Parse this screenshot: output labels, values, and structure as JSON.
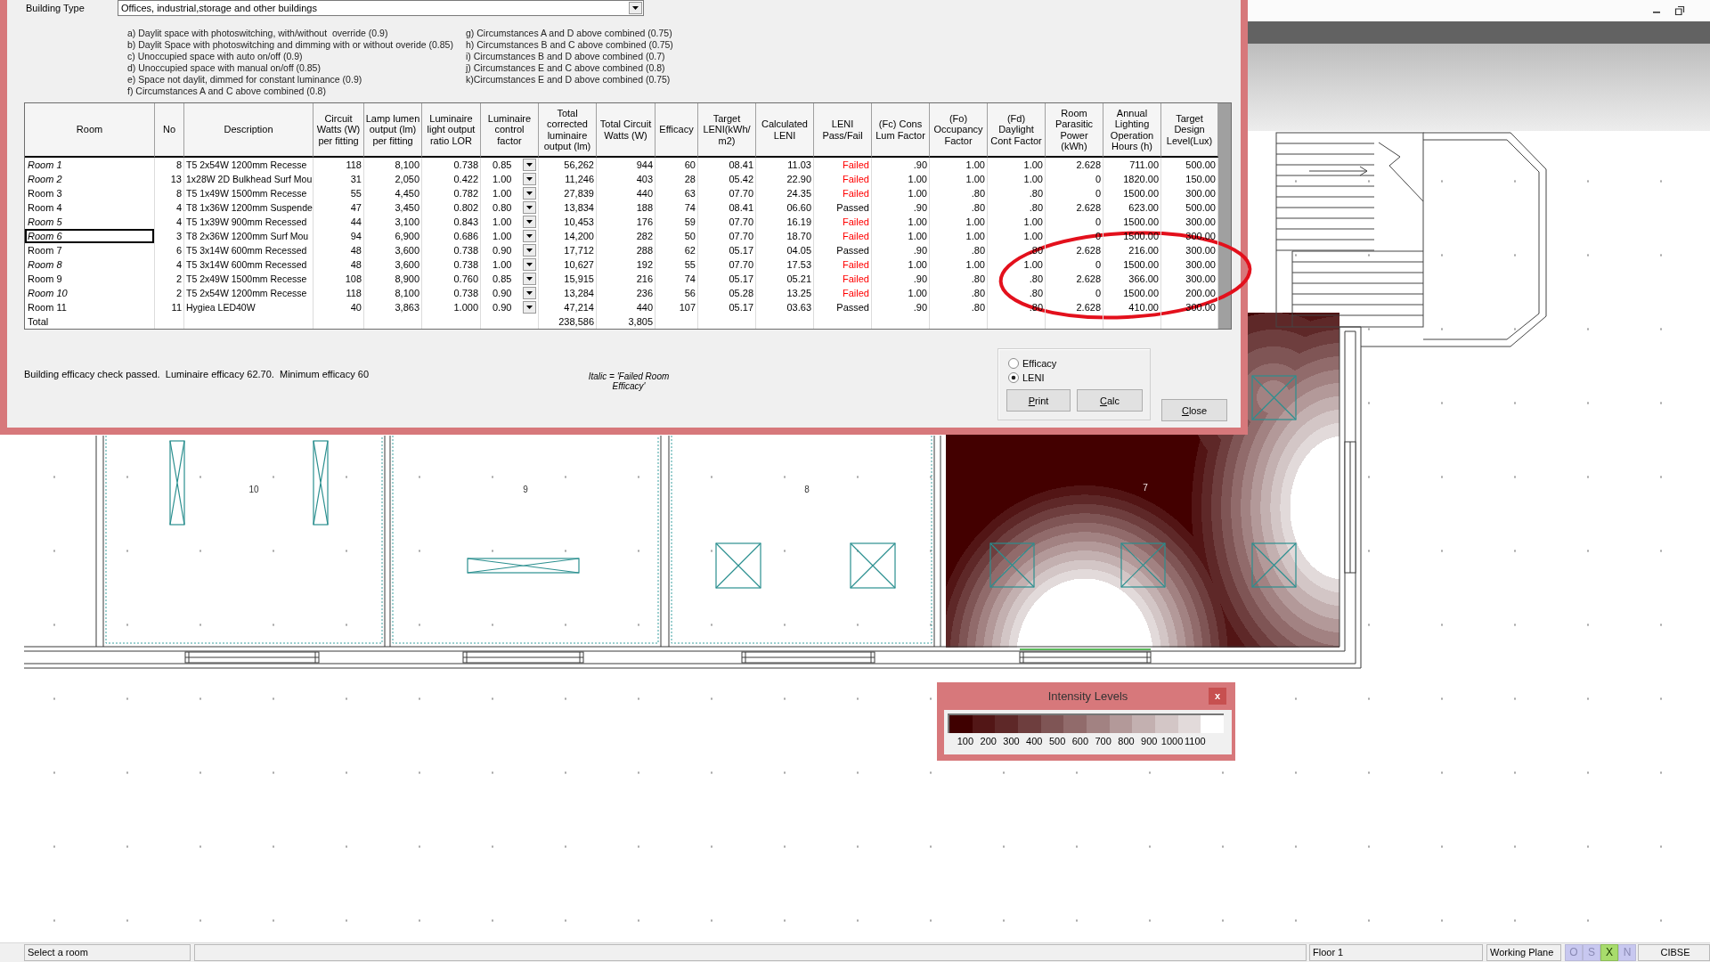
{
  "dialog": {
    "building_type": {
      "label": "Building Type",
      "value": "Offices, industrial,storage and other buildings"
    },
    "factor_notes": [
      {
        "lines": [
          "a) Daylit space with photoswitching, with/without  override (0.9)",
          "b) Daylit Space with photoswitching and dimming with or without overide (0.85)",
          "c) Unoccupied space with auto on/off (0.9)",
          "d) Unoccupied space with manual on/off (0.85)",
          "e) Space not daylit, dimmed for constant luminance (0.9)",
          "f) Circumstances A and C above combined (0.8)"
        ]
      },
      {
        "lines": [
          "g) Circumstances A and D above combined (0.75)",
          "h) Circumstances B and C above combined (0.75)",
          "i) Circumstances B and D above combined (0.7)",
          "j) Circumstances E and C above combined (0.8)",
          "k)Circumstances E and D above combined (0.75)"
        ]
      }
    ],
    "table": {
      "columns": [
        {
          "label": "Room",
          "kind": "room"
        },
        {
          "label": "No",
          "kind": "number"
        },
        {
          "label": "Description",
          "kind": "text"
        },
        {
          "label": "Circuit Watts (W) per fitting",
          "kind": "number"
        },
        {
          "label": "Lamp lumen output (lm) per fitting",
          "kind": "number"
        },
        {
          "label": "Luminaire light output ratio LOR",
          "kind": "number"
        },
        {
          "label": "Luminaire control factor",
          "kind": "dropdown"
        },
        {
          "label": "Total corrected luminaire output (lm)",
          "kind": "number"
        },
        {
          "label": "Total Circuit Watts (W)",
          "kind": "number"
        },
        {
          "label": "Efficacy",
          "kind": "number"
        },
        {
          "label": "Target LENI(kWh/m2)",
          "kind": "number"
        },
        {
          "label": "Calculated LENI",
          "kind": "number"
        },
        {
          "label": "LENI Pass/Fail",
          "kind": "status"
        },
        {
          "label": "(Fc) Cons Lum Factor",
          "kind": "number"
        },
        {
          "label": "(Fo) Occupancy Factor",
          "kind": "number"
        },
        {
          "label": "(Fd) Daylight Cont Factor",
          "kind": "number"
        },
        {
          "label": "Room Parasitic Power (kWh)",
          "kind": "number"
        },
        {
          "label": "Annual Lighting Operation Hours (h)",
          "kind": "number"
        },
        {
          "label": "Target Design Level(Lux)",
          "kind": "number"
        }
      ],
      "rows": [
        {
          "cells": [
            "Room 1",
            "8",
            "T5 2x54W 1200mm Recesse",
            "118",
            "8,100",
            "0.738",
            "0.85",
            "56,262",
            "944",
            "60",
            "08.41",
            "11.03",
            "Failed",
            ".90",
            "1.00",
            "1.00",
            "2.628",
            "711.00",
            "500.00"
          ],
          "efficacy_failed": true,
          "leni_failed": true,
          "selected": false
        },
        {
          "cells": [
            "Room 2",
            "13",
            "1x28W 2D Bulkhead Surf Mou",
            "31",
            "2,050",
            "0.422",
            "1.00",
            "11,246",
            "403",
            "28",
            "05.42",
            "22.90",
            "Failed",
            "1.00",
            "1.00",
            "1.00",
            "0",
            "1820.00",
            "150.00"
          ],
          "efficacy_failed": true,
          "leni_failed": true,
          "selected": false
        },
        {
          "cells": [
            "Room 3",
            "8",
            "T5 1x49W 1500mm Recesse",
            "55",
            "4,450",
            "0.782",
            "1.00",
            "27,839",
            "440",
            "63",
            "07.70",
            "24.35",
            "Failed",
            "1.00",
            ".80",
            ".80",
            "0",
            "1500.00",
            "300.00"
          ],
          "efficacy_failed": false,
          "leni_failed": true,
          "selected": false
        },
        {
          "cells": [
            "Room 4",
            "4",
            "T8 1x36W 1200mm Suspende",
            "47",
            "3,450",
            "0.802",
            "0.80",
            "13,834",
            "188",
            "74",
            "08.41",
            "06.60",
            "Passed",
            ".90",
            ".80",
            ".80",
            "2.628",
            "623.00",
            "500.00"
          ],
          "efficacy_failed": false,
          "leni_failed": false,
          "selected": false
        },
        {
          "cells": [
            "Room 5",
            "4",
            "T5 1x39W 900mm Recessed",
            "44",
            "3,100",
            "0.843",
            "1.00",
            "10,453",
            "176",
            "59",
            "07.70",
            "16.19",
            "Failed",
            "1.00",
            "1.00",
            "1.00",
            "0",
            "1500.00",
            "300.00"
          ],
          "efficacy_failed": true,
          "leni_failed": true,
          "selected": false
        },
        {
          "cells": [
            "Room 6",
            "3",
            "T8 2x36W 1200mm Surf Mou",
            "94",
            "6,900",
            "0.686",
            "1.00",
            "14,200",
            "282",
            "50",
            "07.70",
            "18.70",
            "Failed",
            "1.00",
            "1.00",
            "1.00",
            "0",
            "1500.00",
            "300.00"
          ],
          "efficacy_failed": true,
          "leni_failed": true,
          "selected": true
        },
        {
          "cells": [
            "Room 7",
            "6",
            "T5 3x14W 600mm Recessed",
            "48",
            "3,600",
            "0.738",
            "0.90",
            "17,712",
            "288",
            "62",
            "05.17",
            "04.05",
            "Passed",
            ".90",
            ".80",
            ".80",
            "2.628",
            "216.00",
            "300.00"
          ],
          "efficacy_failed": false,
          "leni_failed": false,
          "selected": false
        },
        {
          "cells": [
            "Room 8",
            "4",
            "T5 3x14W 600mm Recessed",
            "48",
            "3,600",
            "0.738",
            "1.00",
            "10,627",
            "192",
            "55",
            "07.70",
            "17.53",
            "Failed",
            "1.00",
            "1.00",
            "1.00",
            "0",
            "1500.00",
            "300.00"
          ],
          "efficacy_failed": true,
          "leni_failed": true,
          "selected": false
        },
        {
          "cells": [
            "Room 9",
            "2",
            "T5 2x49W 1500mm Recesse",
            "108",
            "8,900",
            "0.760",
            "0.85",
            "15,915",
            "216",
            "74",
            "05.17",
            "05.21",
            "Failed",
            ".90",
            ".80",
            ".80",
            "2.628",
            "366.00",
            "300.00"
          ],
          "efficacy_failed": false,
          "leni_failed": true,
          "selected": false
        },
        {
          "cells": [
            "Room 10",
            "2",
            "T5 2x54W 1200mm Recesse",
            "118",
            "8,100",
            "0.738",
            "0.90",
            "13,284",
            "236",
            "56",
            "05.28",
            "13.25",
            "Failed",
            "1.00",
            ".80",
            ".80",
            "0",
            "1500.00",
            "200.00"
          ],
          "efficacy_failed": true,
          "leni_failed": true,
          "selected": false
        },
        {
          "cells": [
            "Room 11",
            "11",
            "Hygiea LED40W",
            "40",
            "3,863",
            "1.000",
            "0.90",
            "47,214",
            "440",
            "107",
            "05.17",
            "03.63",
            "Passed",
            ".90",
            ".80",
            ".80",
            "2.628",
            "410.00",
            "300.00"
          ],
          "efficacy_failed": false,
          "leni_failed": false,
          "selected": false
        }
      ],
      "total_row": {
        "label": "Total",
        "total_corrected": "238,586",
        "total_circuit": "3,805"
      }
    },
    "status_message": "Building efficacy check passed.  Luminaire efficacy 62.70.  Minimum efficacy 60",
    "legend_note": "Italic = 'Failed Room Efficacy'",
    "mode_options": [
      {
        "label": "Efficacy",
        "selected": false
      },
      {
        "label": "LENI",
        "selected": true
      }
    ],
    "buttons": [
      "Print",
      "Calc"
    ],
    "close_button": "Close"
  },
  "annotations": [
    {
      "kind": "ellipse"
    }
  ],
  "floor_plan": {
    "room_labels": [
      "10",
      "9",
      "8",
      "7"
    ]
  },
  "intensity_window": {
    "title": "Intensity Levels",
    "close_label": "x",
    "swatches": [
      {
        "color": "#3f0000"
      },
      {
        "color": "#521616"
      },
      {
        "color": "#5e2828"
      },
      {
        "color": "#6e3e3e"
      },
      {
        "color": "#7f5555"
      },
      {
        "color": "#916b6b"
      },
      {
        "color": "#a28282"
      },
      {
        "color": "#b39999"
      },
      {
        "color": "#c3b0b0"
      },
      {
        "color": "#d3c6c6"
      },
      {
        "color": "#e2dada"
      },
      {
        "color": "#ffffff"
      }
    ],
    "labels": [
      "100",
      "200",
      "300",
      "400",
      "500",
      "600",
      "700",
      "800",
      "900",
      "1000",
      "1100"
    ]
  },
  "status_bar": {
    "hint": "Select a room",
    "floor": "Floor 1",
    "plane": "Working Plane",
    "toggles": [
      {
        "label": "O",
        "on": false
      },
      {
        "label": "S",
        "on": false
      },
      {
        "label": "X",
        "on": true
      },
      {
        "label": "N",
        "on": false
      }
    ],
    "standard": "CIBSE"
  }
}
